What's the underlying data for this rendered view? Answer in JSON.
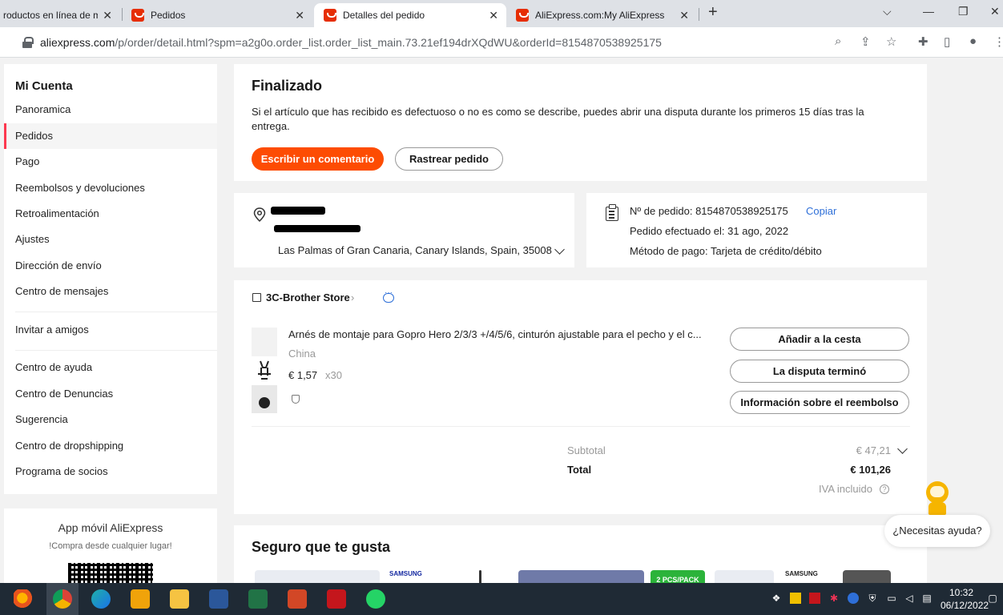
{
  "browser": {
    "tabs": [
      {
        "label": "roductos en línea de m"
      },
      {
        "label": "Pedidos"
      },
      {
        "label": "Detalles del pedido"
      },
      {
        "label": "AliExpress.com:My AliExpress"
      }
    ],
    "url_host": "aliexpress.com",
    "url_path": "/p/order/detail.html?spm=a2g0o.order_list.order_list_main.73.21ef194drXQdWU&orderId=8154870538925175"
  },
  "sidebar": {
    "title": "Mi Cuenta",
    "items": [
      {
        "label": "Panoramica"
      },
      {
        "label": "Pedidos"
      },
      {
        "label": "Pago"
      },
      {
        "label": "Reembolsos y devoluciones"
      },
      {
        "label": "Retroalimentación"
      },
      {
        "label": "Ajustes"
      },
      {
        "label": "Dirección de envío"
      },
      {
        "label": "Centro de mensajes"
      },
      {
        "label": "Invitar a amigos"
      },
      {
        "label": "Centro de ayuda"
      },
      {
        "label": "Centro de Denuncias"
      },
      {
        "label": "Sugerencia"
      },
      {
        "label": "Centro de dropshipping"
      },
      {
        "label": "Programa de socios"
      }
    ],
    "app": {
      "title": "App móvil AliExpress",
      "subtitle": "!Compra desde cualquier lugar!"
    }
  },
  "status": {
    "title": "Finalizado",
    "description": "Si el artículo que has recibido es defectuoso o no es como se describe, puedes abrir una disputa durante los primeros 15 días tras la entrega.",
    "primary_button": "Escribir un comentario",
    "track_button": "Rastrear pedido"
  },
  "address": {
    "line": "Las Palmas of Gran Canaria, Canary Islands, Spain, 35008"
  },
  "order_info": {
    "order_number": "Nº de pedido: 8154870538925175",
    "copy_label": "Copiar",
    "placed": "Pedido efectuado el: 31 ago, 2022",
    "payment": "Método de pago: Tarjeta de crédito/débito"
  },
  "store": {
    "name": "3C-Brother Store",
    "product": {
      "title": "Arnés de montaje para Gopro Hero 2/3/3 +/4/5/6, cinturón ajustable para el pecho y el c...",
      "origin": "China",
      "price": "€ 1,57",
      "quantity": "x30"
    },
    "actions": {
      "add_to_cart": "Añadir a la cesta",
      "dispute": "La disputa terminó",
      "refund_info": "Información sobre el reembolso"
    }
  },
  "summary": {
    "subtotal_label": "Subtotal",
    "subtotal_value": "€ 47,21",
    "total_label": "Total",
    "total_value": "€ 101,26",
    "vat_note": "IVA incluido",
    "vat_help_glyph": "?"
  },
  "recommendations": {
    "title": "Seguro que te gusta",
    "thumb_labels": [
      "SAMSUNG",
      "2 PCS/PACK",
      "SAMSUNG"
    ]
  },
  "help": {
    "label": "¿Necesitas ayuda?"
  },
  "taskbar": {
    "time": "10:32",
    "date": "06/12/2022"
  },
  "colors": {
    "accent": "#fd4c03",
    "active_marker": "#fd384f",
    "link": "#2e6fd8",
    "taskbar": "#1f2a35"
  }
}
